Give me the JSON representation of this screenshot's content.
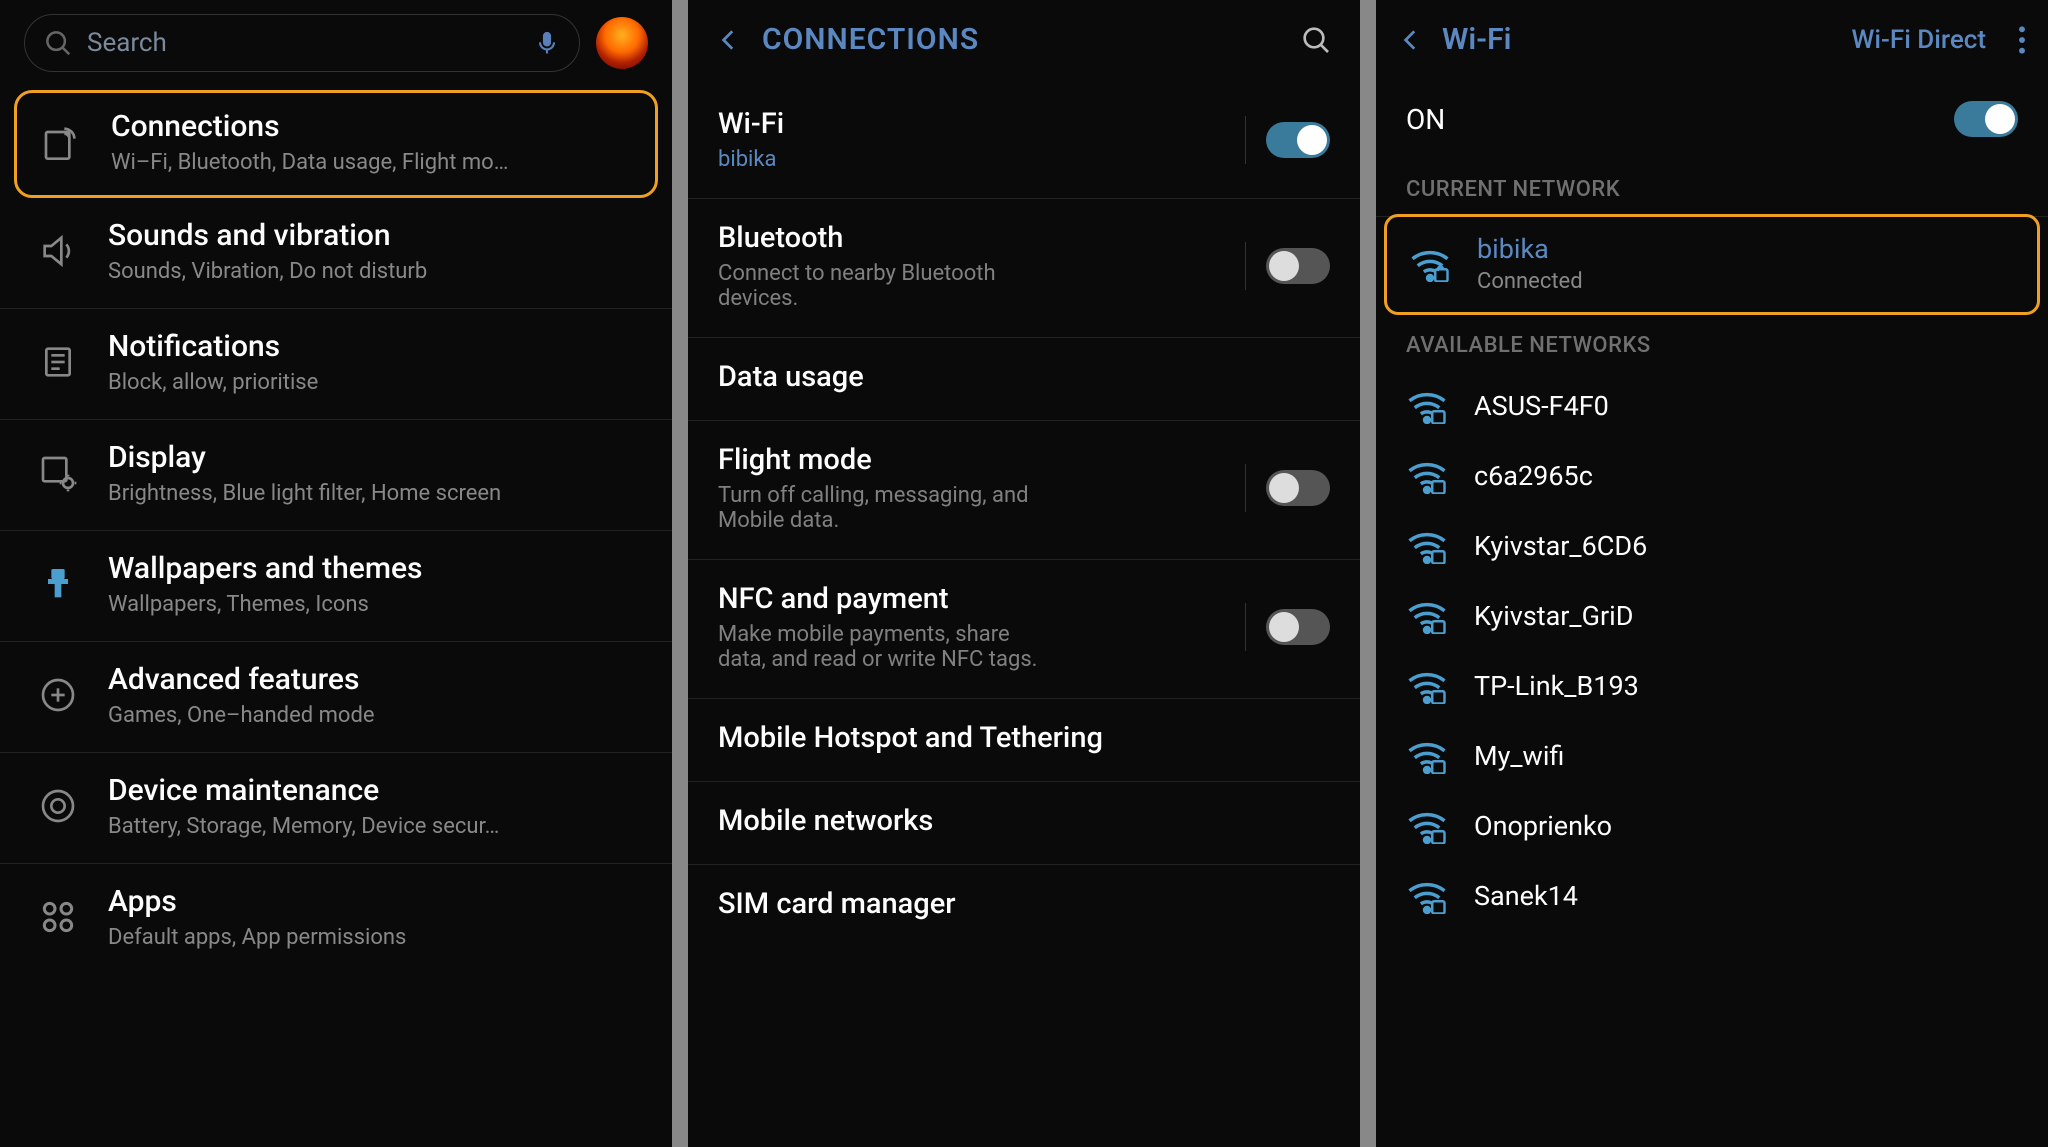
{
  "panel1": {
    "search_placeholder": "Search",
    "items": [
      {
        "title": "Connections",
        "sub": "Wi–Fi, Bluetooth, Data usage, Flight mo…"
      },
      {
        "title": "Sounds and vibration",
        "sub": "Sounds, Vibration, Do not disturb"
      },
      {
        "title": "Notifications",
        "sub": "Block, allow, prioritise"
      },
      {
        "title": "Display",
        "sub": "Brightness, Blue light filter, Home screen"
      },
      {
        "title": "Wallpapers and themes",
        "sub": "Wallpapers, Themes, Icons"
      },
      {
        "title": "Advanced features",
        "sub": "Games, One–handed mode"
      },
      {
        "title": "Device maintenance",
        "sub": "Battery, Storage, Memory, Device secur…"
      },
      {
        "title": "Apps",
        "sub": "Default apps, App permissions"
      }
    ]
  },
  "panel2": {
    "header": "CONNECTIONS",
    "items": [
      {
        "title": "Wi-Fi",
        "sub": "bibika",
        "sub_accent": true,
        "toggle": "on"
      },
      {
        "title": "Bluetooth",
        "sub": "Connect to nearby Bluetooth devices.",
        "toggle": "off"
      },
      {
        "title": "Data usage",
        "sub": "",
        "toggle": null
      },
      {
        "title": "Flight mode",
        "sub": "Turn off calling, messaging, and Mobile data.",
        "toggle": "off"
      },
      {
        "title": "NFC and payment",
        "sub": "Make mobile payments, share data, and read or write NFC tags.",
        "toggle": "off"
      },
      {
        "title": "Mobile Hotspot and Tethering",
        "sub": "",
        "toggle": null
      },
      {
        "title": "Mobile networks",
        "sub": "",
        "toggle": null
      },
      {
        "title": "SIM card manager",
        "sub": "",
        "toggle": null
      }
    ]
  },
  "panel3": {
    "header": "Wi-Fi",
    "direct_label": "Wi-Fi Direct",
    "on_label": "ON",
    "current_section": "CURRENT NETWORK",
    "available_section": "AVAILABLE NETWORKS",
    "current": {
      "ssid": "bibika",
      "status": "Connected"
    },
    "networks": [
      {
        "ssid": "ASUS-F4F0"
      },
      {
        "ssid": "c6a2965c"
      },
      {
        "ssid": "Kyivstar_6CD6"
      },
      {
        "ssid": "Kyivstar_GriD"
      },
      {
        "ssid": "TP-Link_B193"
      },
      {
        "ssid": "My_wifi"
      },
      {
        "ssid": "Onoprienko"
      },
      {
        "ssid": "Sanek14"
      }
    ]
  }
}
